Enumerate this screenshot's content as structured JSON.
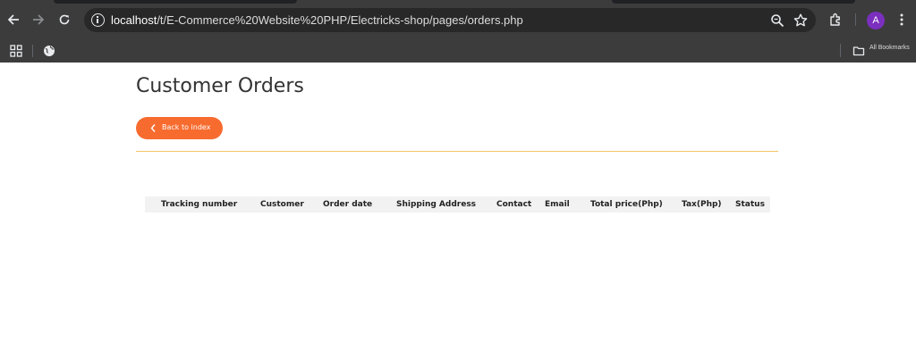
{
  "browser": {
    "url_host": "localhost",
    "url_path": "/t/E-Commerce%20Website%20PHP/Electricks-shop/pages/orders.php",
    "profile_initial": "A",
    "bookmarks_label": "All Bookmarks",
    "icons": [
      "back-arrow-icon",
      "forward-arrow-icon",
      "reload-icon",
      "info-icon",
      "zoom-icon",
      "star-icon",
      "extensions-icon",
      "kebab-menu-icon",
      "apps-grid-icon",
      "globe-icon",
      "folder-icon"
    ]
  },
  "page": {
    "title": "Customer Orders",
    "back_button_label": "Back to index",
    "accent_color": "#f76b2f",
    "divider_color": "#f4c46a"
  },
  "orders_table": {
    "columns": [
      "Tracking number",
      "Customer",
      "Order date",
      "Shipping Address",
      "Contact",
      "Email",
      "Total price(Php)",
      "Tax(Php)",
      "Status"
    ],
    "rows": []
  }
}
